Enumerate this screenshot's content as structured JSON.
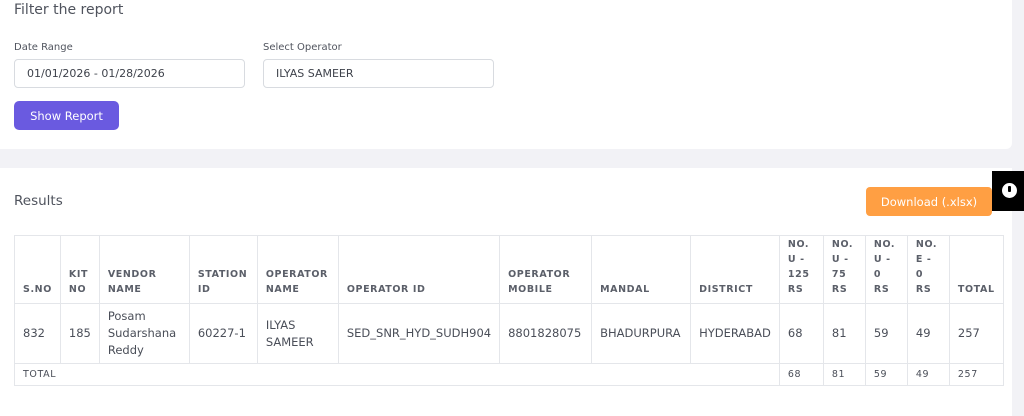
{
  "filter": {
    "title": "Filter the report",
    "date_range_label": "Date Range",
    "date_range_value": "01/01/2026 - 01/28/2026",
    "operator_label": "Select Operator",
    "operator_value": "ILYAS SAMEER",
    "show_report_label": "Show Report"
  },
  "results": {
    "title": "Results",
    "download_label": "Download (.xlsx)",
    "columns": [
      "S.NO",
      "KIT NO",
      "VENDOR NAME",
      "STATION ID",
      "OPERATOR NAME",
      "OPERATOR ID",
      "OPERATOR MOBILE",
      "MANDAL",
      "DISTRICT",
      "NO. U - 125 RS",
      "NO. U - 75 RS",
      "NO. U - 0 RS",
      "NO. E - 0 RS",
      "TOTAL"
    ],
    "rows": [
      [
        "832",
        "185",
        "Posam Sudarshana Reddy",
        "60227-1",
        "ILYAS SAMEER",
        "SED_SNR_HYD_SUDH904",
        "8801828075",
        "BHADURPURA",
        "HYDERABAD",
        "68",
        "81",
        "59",
        "49",
        "257"
      ]
    ],
    "total_row": {
      "label": "TOTAL",
      "values": [
        "68",
        "81",
        "59",
        "49",
        "257"
      ]
    }
  },
  "colors": {
    "primary_button": "#6a5ae0",
    "download_button": "#ff9f43",
    "background": "#f2f2f6"
  },
  "side_tab_icon": "info-bubble-icon"
}
